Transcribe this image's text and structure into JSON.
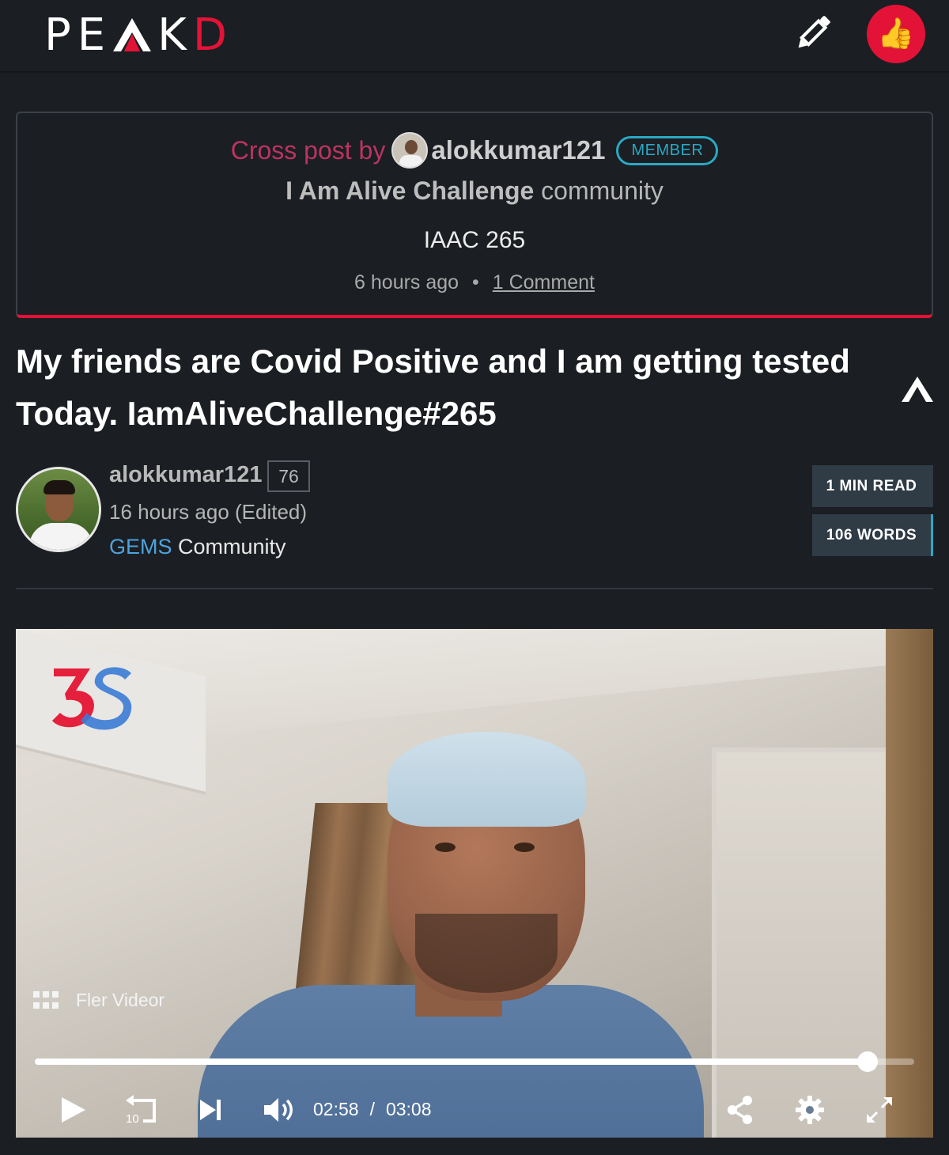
{
  "header": {
    "logo_prefix": "PE",
    "logo_suffix_k": "K",
    "logo_suffix_d": "D",
    "edit_icon": "pencil-icon",
    "vote_icon": "thumbs-up-icon",
    "vote_emoji": "👍"
  },
  "cross_post": {
    "label": "Cross post by",
    "author": "alokkumar121",
    "member_badge": "MEMBER",
    "community_name": "I Am Alive Challenge",
    "community_suffix": "community",
    "title": "IAAC 265",
    "time": "6 hours ago",
    "separator": "•",
    "comments": "1 Comment"
  },
  "post": {
    "title": "My friends are Covid Positive and I am getting tested Today. IamAliveChallenge#265",
    "author": "alokkumar121",
    "reputation": "76",
    "time": "16 hours ago (Edited)",
    "community_highlight": "GEMS",
    "community_suffix": "Community",
    "read_time": "1 MIN READ",
    "word_count": "106 WORDS"
  },
  "video": {
    "brand_mark": "3S",
    "provider_label": "Fler Videor",
    "current_time": "02:58",
    "time_separator": "/",
    "duration": "03:08",
    "progress_fraction": 0.947,
    "rewind_label": "10",
    "icons": [
      "play-icon",
      "rewind-10-icon",
      "skip-next-icon",
      "volume-icon",
      "share-icon",
      "settings-icon",
      "fullscreen-icon"
    ]
  },
  "colors": {
    "background": "#1b1e22",
    "accent_red": "#e31337",
    "accent_cyan": "#2aa8c4",
    "link_blue": "#4da3e0"
  }
}
